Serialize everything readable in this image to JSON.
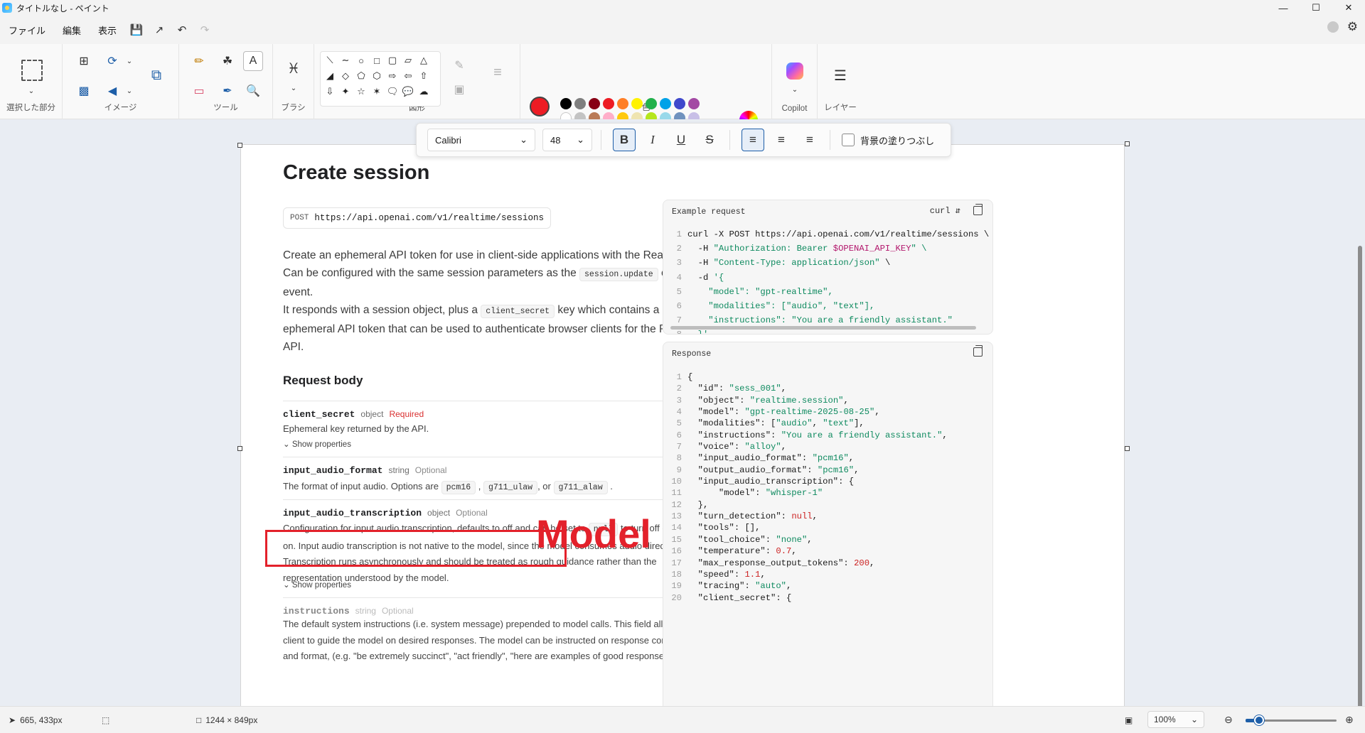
{
  "window": {
    "title": "タイトルなし - ペイント",
    "minimize": "—",
    "maximize": "☐",
    "close": "✕"
  },
  "menu": {
    "file": "ファイル",
    "edit": "編集",
    "view": "表示"
  },
  "ribbon": {
    "selection_label": "選択した部分",
    "image_label": "イメージ",
    "tools_label": "ツール",
    "brush_label": "ブラシ",
    "shapes_label": "図形",
    "colors_label": "色",
    "copilot_label": "Copilot",
    "layers_label": "レイヤー",
    "palette_row1": [
      "#000000",
      "#7f7f7f",
      "#880015",
      "#ed1c24",
      "#ff7f27",
      "#fff200",
      "#22b14c",
      "#00a2e8",
      "#3f48cc",
      "#a349a4"
    ],
    "palette_row2": [
      "empty",
      "#c3c3c3",
      "#b97a57",
      "#ffaec9",
      "#ffc90e",
      "#efe4b0",
      "#b5e61d",
      "#99d9ea",
      "#7092be",
      "#c8bfe7"
    ],
    "primary_color": "#ed1c24"
  },
  "format": {
    "font": "Calibri",
    "size": "48",
    "bold": "B",
    "italic": "I",
    "underline": "U",
    "strike": "S",
    "fill_label": "背景の塗りつぶし"
  },
  "doc": {
    "title": "Create session",
    "method": "POST",
    "url": "https://api.openai.com/v1/realtime/sessions",
    "p1a": "Create an ephemeral API token for use in client-side applications with the Realtime API.",
    "p1b": "Can be configured with the same session parameters as the",
    "p1code": "session.update",
    "p1c": "client",
    "p1d": "event.",
    "p2a": "It responds with a session object, plus a",
    "p2code": "client_secret",
    "p2b": "key which contains a usable",
    "p2c": "ephemeral API token that can be used to authenticate browser clients for the Realtime",
    "p2d": "API.",
    "request_body": "Request body",
    "props": [
      {
        "name": "client_secret",
        "type": "object",
        "flag": "Required",
        "desc": "Ephemeral key returned by the API.",
        "show": "Show properties"
      },
      {
        "name": "input_audio_format",
        "type": "string",
        "flag": "Optional",
        "desc": "The format of input audio. Options are",
        "opt1": "pcm16",
        "opt2": "g711_ulaw",
        "or": ", or",
        "opt3": "g711_alaw"
      },
      {
        "name": "input_audio_transcription",
        "type": "object",
        "flag": "Optional",
        "desc1": "Configuration for input audio transcription, defaults to off and can be set to",
        "code": "null",
        "desc2": "to turn off once",
        "desc3": "on. Input audio transcription is not native to the model, since the model consumes audio directly.",
        "desc4": "Transcription runs asynchronously and should be treated as rough guidance rather than the",
        "desc5": "representation understood by the model.",
        "show": "Show properties"
      },
      {
        "name": "instructions",
        "type": "string",
        "flag": "Optional",
        "desc1": "The default system instructions (i.e. system message) prepended to model calls. This field allows the",
        "desc2": "client to guide the model on desired responses. The model can be instructed on response content",
        "desc3": "and format, (e.g. \"be extremely succinct\", \"act friendly\", \"here are examples of good responses\") and"
      }
    ],
    "annotation": "Model"
  },
  "example": {
    "header": "Example request",
    "lang": "curl",
    "lines": [
      [
        "curl -X POST https://api.openai.com/v1/realtime/sessions \\"
      ],
      [
        "  -H ",
        "\"Authorization: Bearer ",
        "$OPENAI_API_KEY",
        "\" \\"
      ],
      [
        "  -H ",
        "\"Content-Type: application/json\"",
        " \\"
      ],
      [
        "  -d ",
        "'{"
      ],
      [
        "    \"model\": \"gpt-realtime\","
      ],
      [
        "    \"modalities\": [\"audio\", \"text\"],"
      ],
      [
        "    \"instructions\": \"You are a friendly assistant.\""
      ],
      [
        "  }'"
      ]
    ]
  },
  "response": {
    "header": "Response",
    "lines": [
      "{",
      "  \"id\": \"sess_001\",",
      "  \"object\": \"realtime.session\",",
      "  \"model\": \"gpt-realtime-2025-08-25\",",
      "  \"modalities\": [\"audio\", \"text\"],",
      "  \"instructions\": \"You are a friendly assistant.\",",
      "  \"voice\": \"alloy\",",
      "  \"input_audio_format\": \"pcm16\",",
      "  \"output_audio_format\": \"pcm16\",",
      "  \"input_audio_transcription\": {",
      "      \"model\": \"whisper-1\"",
      "  },",
      "  \"turn_detection\": null,",
      "  \"tools\": [],",
      "  \"tool_choice\": \"none\",",
      "  \"temperature\": 0.7,",
      "  \"max_response_output_tokens\": 200,",
      "  \"speed\": 1.1,",
      "  \"tracing\": \"auto\",",
      "  \"client_secret\": {"
    ]
  },
  "status": {
    "cursor": "665, 433px",
    "size": "1244 × 849px",
    "zoom": "100%",
    "zoom_level": 0.15
  }
}
